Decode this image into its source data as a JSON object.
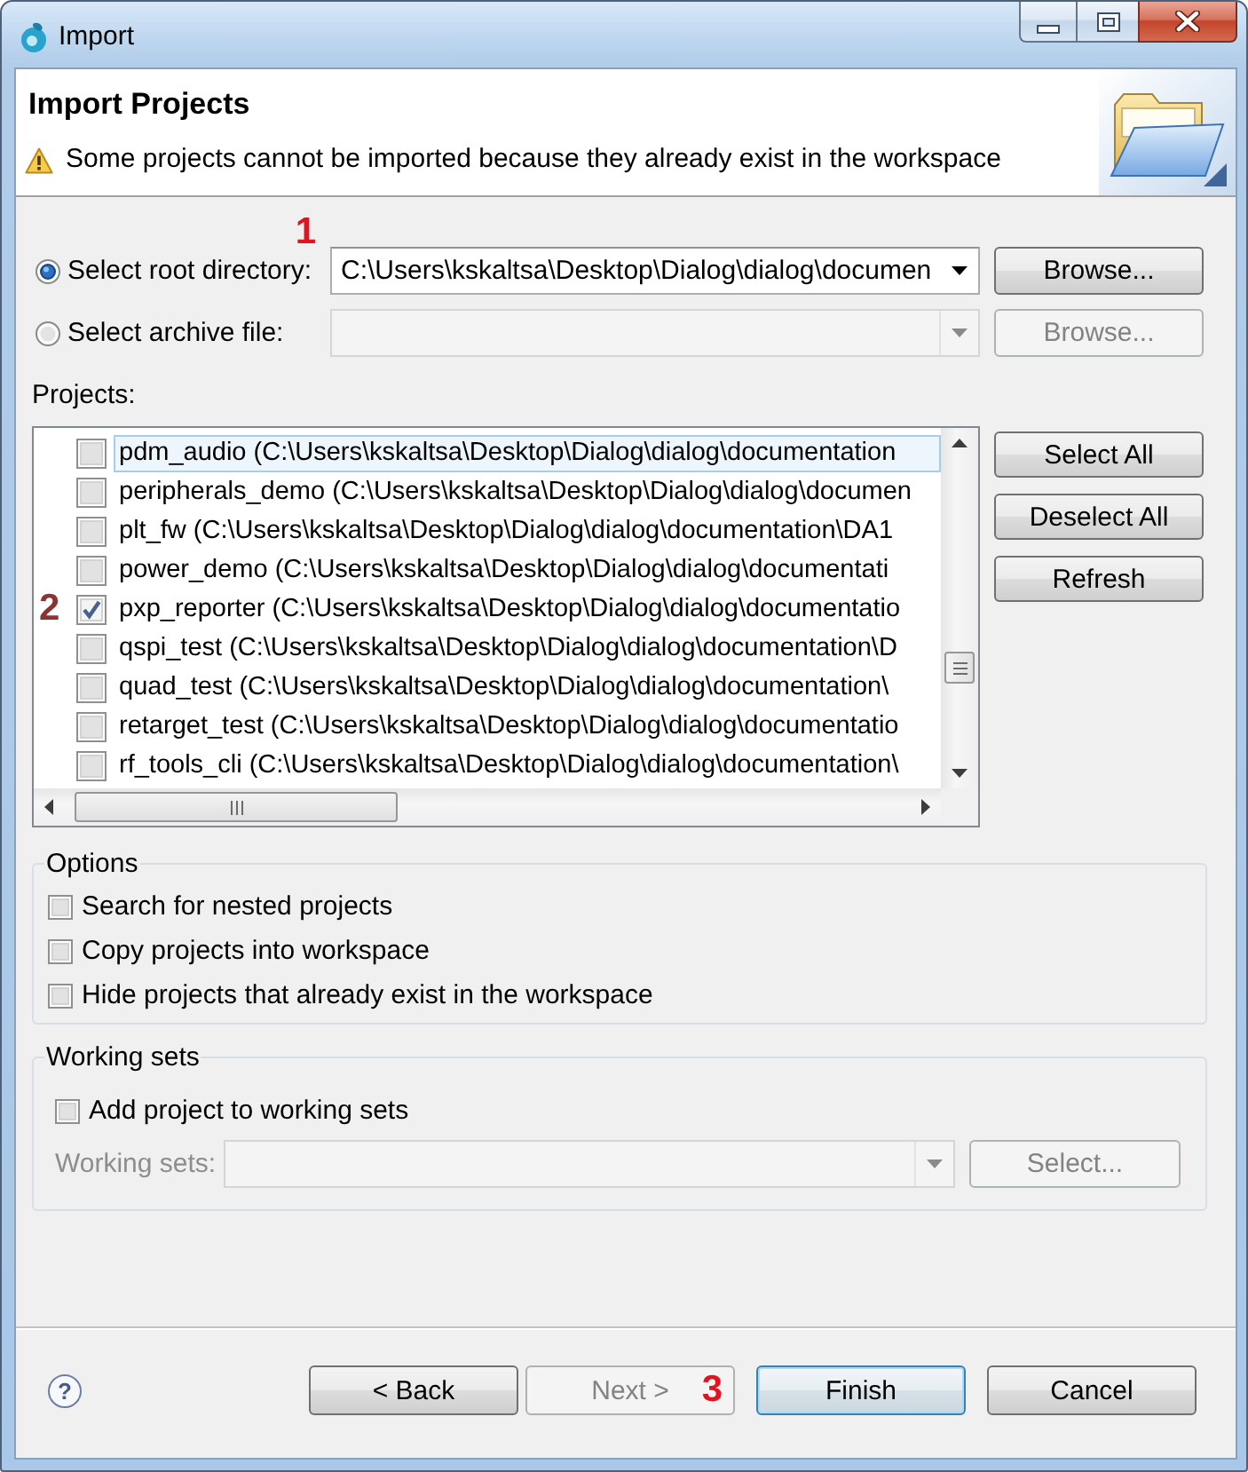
{
  "window": {
    "title": "Import"
  },
  "header": {
    "title": "Import Projects",
    "message": "Some projects cannot be imported because they already exist in the workspace"
  },
  "source": [
    {
      "label": "Select root directory:",
      "selected": true,
      "value": "C:\\Users\\kskaltsa\\Desktop\\Dialog\\dialog\\documen",
      "disabled": false,
      "button": "Browse...",
      "annotation": "1"
    },
    {
      "label": "Select archive file:",
      "selected": false,
      "disabled": true,
      "button": "Browse..."
    }
  ],
  "projects": {
    "label": "Projects:",
    "items": [
      {
        "name": "pdm_audio (C:\\Users\\kskaltsa\\Desktop\\Dialog\\dialog\\documentation",
        "checked": false,
        "selected": true
      },
      {
        "name": "peripherals_demo (C:\\Users\\kskaltsa\\Desktop\\Dialog\\dialog\\documen",
        "checked": false,
        "selected": false
      },
      {
        "name": "plt_fw (C:\\Users\\kskaltsa\\Desktop\\Dialog\\dialog\\documentation\\DA1",
        "checked": false,
        "selected": false
      },
      {
        "name": "power_demo (C:\\Users\\kskaltsa\\Desktop\\Dialog\\dialog\\documentati",
        "checked": false,
        "selected": false
      },
      {
        "name": "pxp_reporter (C:\\Users\\kskaltsa\\Desktop\\Dialog\\dialog\\documentatio",
        "checked": true,
        "selected": false,
        "annotation": "2"
      },
      {
        "name": "qspi_test (C:\\Users\\kskaltsa\\Desktop\\Dialog\\dialog\\documentation\\D",
        "checked": false,
        "selected": false
      },
      {
        "name": "quad_test (C:\\Users\\kskaltsa\\Desktop\\Dialog\\dialog\\documentation\\",
        "checked": false,
        "selected": false
      },
      {
        "name": "retarget_test (C:\\Users\\kskaltsa\\Desktop\\Dialog\\dialog\\documentatio",
        "checked": false,
        "selected": false
      },
      {
        "name": "rf_tools_cli (C:\\Users\\kskaltsa\\Desktop\\Dialog\\dialog\\documentation\\",
        "checked": false,
        "selected": false
      }
    ]
  },
  "project_buttons": [
    "Select All",
    "Deselect All",
    "Refresh"
  ],
  "options": {
    "title": "Options",
    "items": [
      {
        "label": "Search for nested projects",
        "checked": false
      },
      {
        "label": "Copy projects into workspace",
        "checked": false
      },
      {
        "label": "Hide projects that already exist in the workspace",
        "checked": false
      }
    ]
  },
  "working_sets": {
    "title": "Working sets",
    "add": {
      "label": "Add project to working sets",
      "checked": false
    },
    "field_label": "Working sets:",
    "disabled": true,
    "button": "Select..."
  },
  "help": "?",
  "buttons": [
    {
      "label": "< Back",
      "disabled": false,
      "default": false
    },
    {
      "label": "Next >",
      "disabled": true,
      "default": false,
      "annotation": "3"
    },
    {
      "label": "Finish",
      "disabled": false,
      "default": true
    },
    {
      "label": "Cancel",
      "disabled": false,
      "default": false
    }
  ]
}
